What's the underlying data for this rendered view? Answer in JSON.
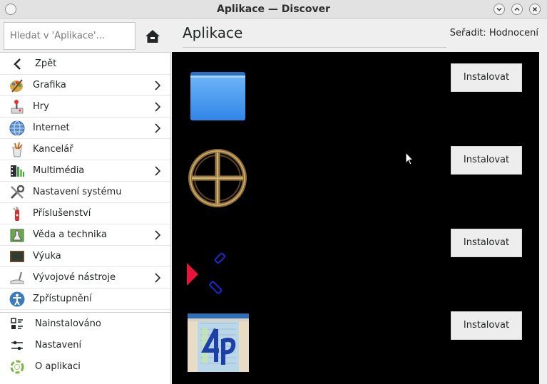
{
  "window": {
    "title": "Aplikace — Discover"
  },
  "search": {
    "placeholder": "Hledat v 'Aplikace'..."
  },
  "sidebar": {
    "back_label": "Zpět",
    "categories": [
      {
        "label": "Grafika",
        "icon": "graphics-icon",
        "has_children": true
      },
      {
        "label": "Hry",
        "icon": "games-icon",
        "has_children": true
      },
      {
        "label": "Internet",
        "icon": "internet-globe-icon",
        "has_children": true
      },
      {
        "label": "Kancelář",
        "icon": "office-icon",
        "has_children": false
      },
      {
        "label": "Multimédia",
        "icon": "multimedia-icon",
        "has_children": true
      },
      {
        "label": "Nastavení systému",
        "icon": "system-settings-icon",
        "has_children": false
      },
      {
        "label": "Příslušenství",
        "icon": "accessories-icon",
        "has_children": false
      },
      {
        "label": "Věda a technika",
        "icon": "science-icon",
        "has_children": true
      },
      {
        "label": "Výuka",
        "icon": "education-icon",
        "has_children": false
      },
      {
        "label": "Vývojové nástroje",
        "icon": "development-icon",
        "has_children": true
      },
      {
        "label": "Zpřístupnění",
        "icon": "accessibility-icon",
        "has_children": false
      }
    ],
    "bottom_items": [
      {
        "label": "Nainstalováno",
        "icon": "installed-icon"
      },
      {
        "label": "Nastavení",
        "icon": "settings-icon"
      },
      {
        "label": "O aplikaci",
        "icon": "about-icon"
      }
    ]
  },
  "main": {
    "title": "Aplikace",
    "sort_label": "Seřadit: Hodnocení",
    "apps": [
      {
        "icon": "blue-folder-icon",
        "install_label": "Instalovat"
      },
      {
        "icon": "wheel-cross-icon",
        "install_label": "Instalovat"
      },
      {
        "icon": "red-arrow-game-icon",
        "install_label": "Instalovat"
      },
      {
        "icon": "4p-app-icon",
        "install_label": "Instalovat"
      }
    ]
  },
  "colors": {
    "list_background": "#000000",
    "sidebar_background": "#ffffff",
    "window_background": "#efefef"
  }
}
